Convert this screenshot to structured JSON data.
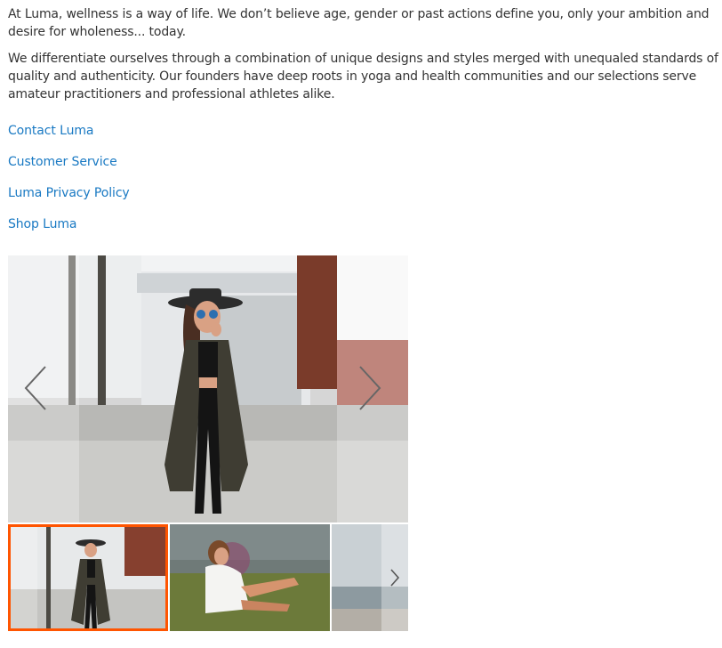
{
  "intro": {
    "paragraph_1": "At Luma, wellness is a way of life. We don’t believe age, gender or past actions define you, only your ambition and desire for wholeness... today.",
    "paragraph_2": "We differentiate ourselves through a combination of unique designs and styles merged with unequaled standards of quality and authenticity. Our founders have deep roots in yoga and health communities and our selections serve amateur practitioners and professional athletes alike."
  },
  "links": [
    {
      "label": "Contact Luma"
    },
    {
      "label": "Customer Service"
    },
    {
      "label": "Luma Privacy Policy"
    },
    {
      "label": "Shop Luma"
    }
  ],
  "gallery": {
    "prev_icon": "chevron-left-icon",
    "next_icon": "chevron-right-icon",
    "active_thumbnail_index": 0,
    "thumbnail_count_visible": 3,
    "colors": {
      "active_border": "#ff5501",
      "link": "#1979c3"
    }
  }
}
